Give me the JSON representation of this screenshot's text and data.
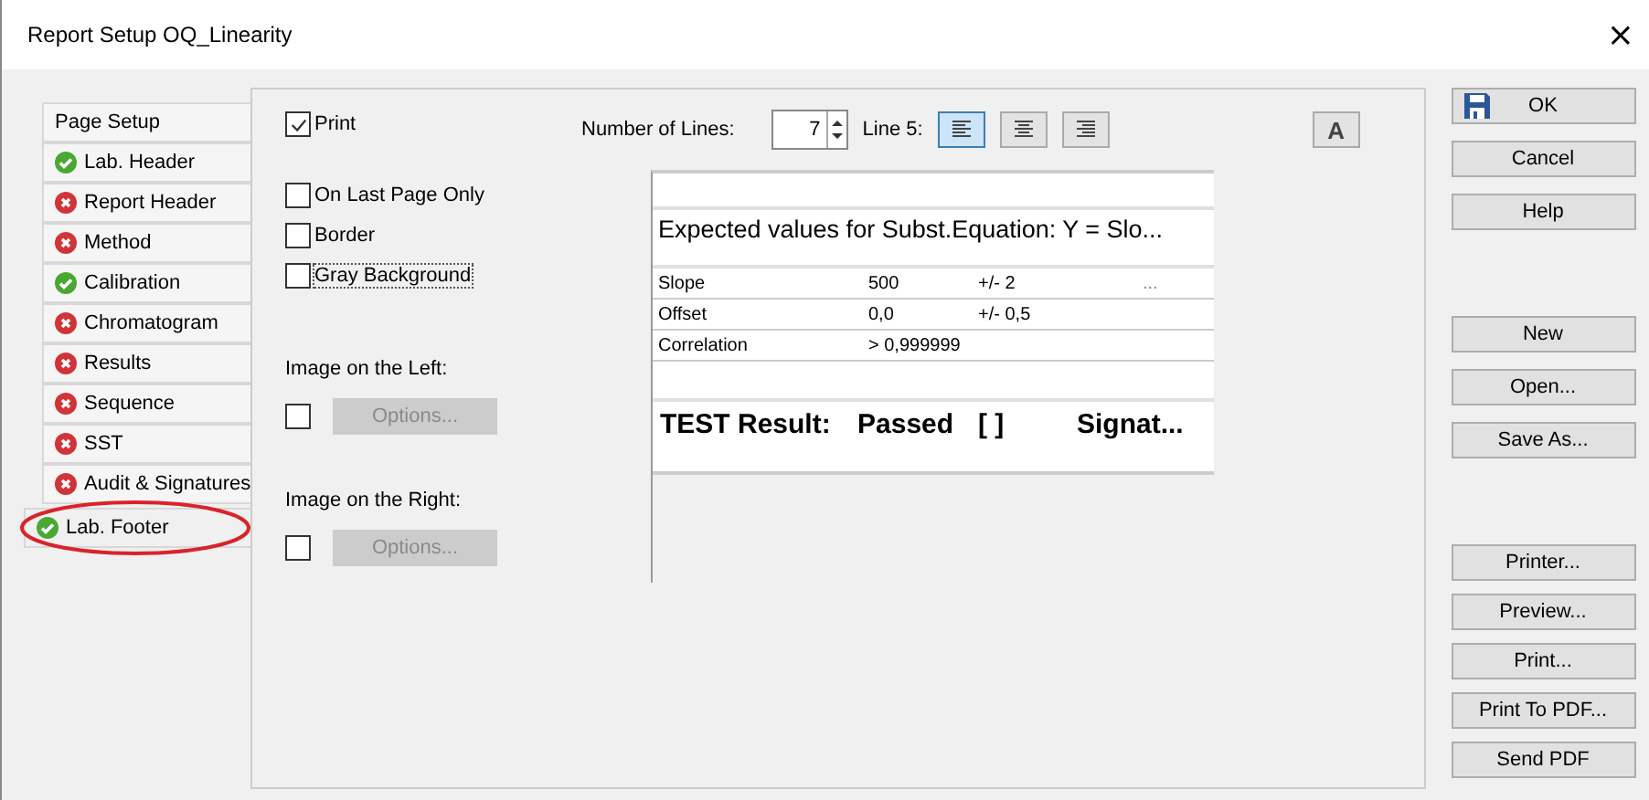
{
  "window": {
    "title": "Report Setup OQ_Linearity",
    "close": "×"
  },
  "tabs": [
    {
      "label": "Page Setup",
      "kind": "plain",
      "selected": false
    },
    {
      "label": "Lab. Header",
      "kind": "ok",
      "selected": false
    },
    {
      "label": "Report Header",
      "kind": "error",
      "selected": false
    },
    {
      "label": "Method",
      "kind": "error",
      "selected": false
    },
    {
      "label": "Calibration",
      "kind": "ok",
      "selected": false
    },
    {
      "label": "Chromatogram",
      "kind": "error",
      "selected": false
    },
    {
      "label": "Results",
      "kind": "error",
      "selected": false
    },
    {
      "label": "Sequence",
      "kind": "error",
      "selected": false
    },
    {
      "label": "SST",
      "kind": "error",
      "selected": false
    },
    {
      "label": "Audit & Signatures",
      "kind": "error",
      "selected": false
    },
    {
      "label": "Lab. Footer",
      "kind": "ok",
      "selected": true,
      "circled": true
    }
  ],
  "print": {
    "label": "Print",
    "checked": true
  },
  "lines": {
    "label": "Number of Lines:",
    "value": "7"
  },
  "line_label": "Line 5:",
  "align_buttons": [
    {
      "kind": "left",
      "selected": true
    },
    {
      "kind": "center",
      "selected": false
    },
    {
      "kind": "right",
      "selected": false
    }
  ],
  "font_button": "A",
  "options": [
    {
      "label": "On Last Page Only",
      "checked": false,
      "focused": false
    },
    {
      "label": "Border",
      "checked": false,
      "focused": false
    },
    {
      "label": "Gray Background",
      "checked": false,
      "focused": true
    }
  ],
  "images": [
    {
      "label": "Image on the Left:",
      "checked": false,
      "button": "Options...",
      "disabled": true
    },
    {
      "label": "Image on the Right:",
      "checked": false,
      "button": "Options...",
      "disabled": true
    }
  ],
  "preview": {
    "heading": "Expected values for Subst.Equation:   Y = Slo...",
    "rows": [
      [
        "Slope",
        "500",
        "+/- 2",
        "..."
      ],
      [
        "Offset",
        "0,0",
        "+/- 0,5"
      ],
      [
        "Correlation",
        "> 0,999999"
      ]
    ],
    "result": [
      "TEST Result:",
      "Passed",
      "[   ]",
      "Signat..."
    ]
  },
  "button_groups": [
    [
      "OK",
      "Cancel",
      "Help"
    ],
    [
      "New",
      "Open...",
      "Save As..."
    ],
    [
      "Printer...",
      "Preview...",
      "Print...",
      "Print To PDF...",
      "Send PDF"
    ]
  ]
}
